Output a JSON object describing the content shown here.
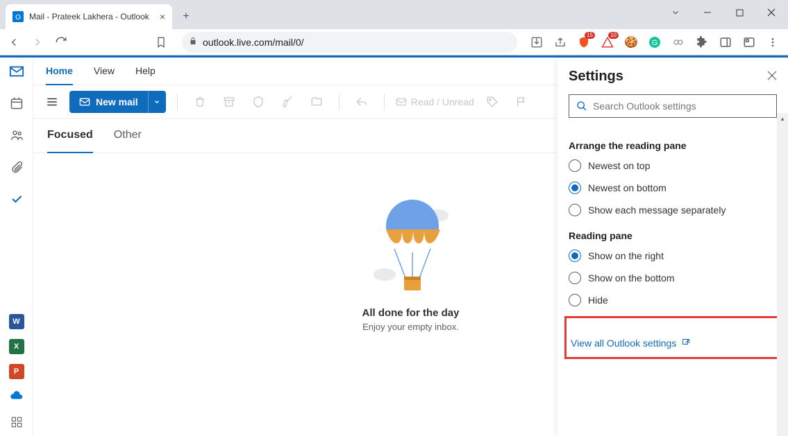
{
  "browser": {
    "tab_title": "Mail - Prateek Lakhera - Outlook",
    "url": "outlook.live.com/mail/0/",
    "ext_badge_brave": "15",
    "ext_badge_tri": "10"
  },
  "ribbon": {
    "home": "Home",
    "view": "View",
    "help": "Help"
  },
  "commands": {
    "new_mail": "New mail",
    "read_unread": "Read / Unread"
  },
  "focus_tabs": {
    "focused": "Focused",
    "other": "Other"
  },
  "empty": {
    "title": "All done for the day",
    "subtitle": "Enjoy your empty inbox."
  },
  "settings": {
    "title": "Settings",
    "search_placeholder": "Search Outlook settings",
    "arrange": {
      "heading": "Arrange the reading pane",
      "options": [
        {
          "label": "Newest on top",
          "checked": false
        },
        {
          "label": "Newest on bottom",
          "checked": true
        },
        {
          "label": "Show each message separately",
          "checked": false
        }
      ]
    },
    "reading": {
      "heading": "Reading pane",
      "options": [
        {
          "label": "Show on the right",
          "checked": true
        },
        {
          "label": "Show on the bottom",
          "checked": false
        },
        {
          "label": "Hide",
          "checked": false
        }
      ]
    },
    "view_all": "View all Outlook settings"
  }
}
